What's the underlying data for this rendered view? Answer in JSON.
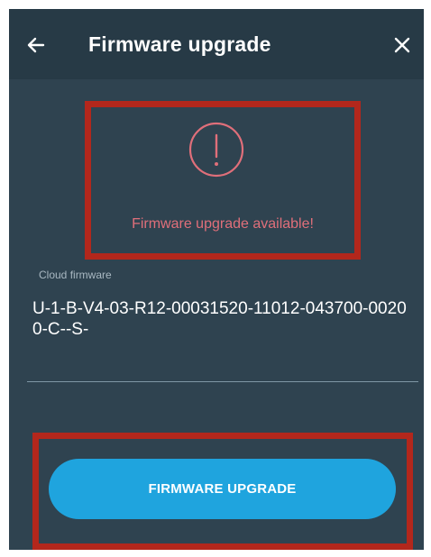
{
  "header": {
    "title": "Firmware upgrade",
    "back_icon": "arrow-left-icon",
    "close_icon": "close-icon"
  },
  "alert": {
    "icon": "exclamation-circle-icon",
    "message": "Firmware upgrade available!"
  },
  "cloud_firmware": {
    "label": "Cloud firmware",
    "value": "U-1-B-V4-03-R12-00031520-11012-043700-00200-C--S-"
  },
  "actions": {
    "upgrade_label": "FIRMWARE UPGRADE"
  },
  "colors": {
    "background": "#2f4350",
    "header": "#273a46",
    "alert": "#e06f7a",
    "button": "#1fa4de",
    "highlight": "#b3271c"
  }
}
